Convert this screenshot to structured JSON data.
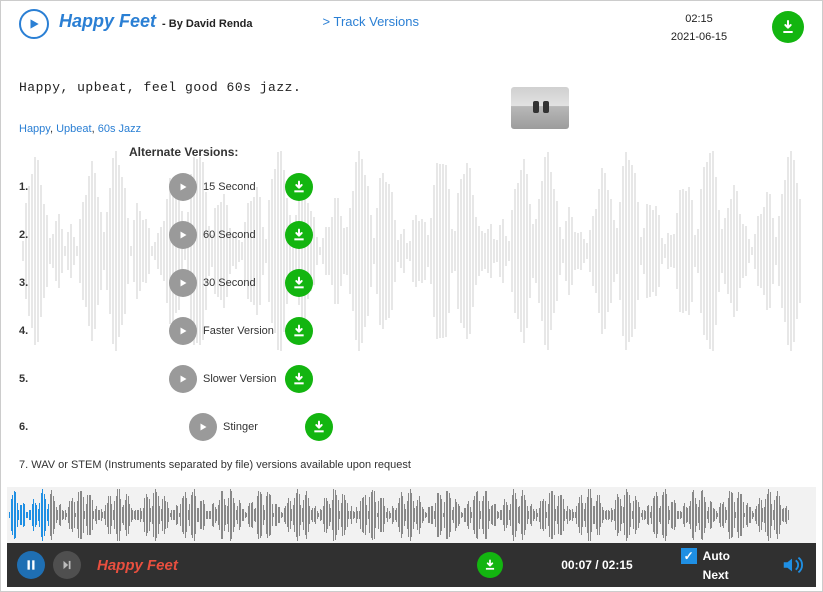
{
  "header": {
    "title": "Happy Feet",
    "by_prefix": "- By",
    "author": "David Renda",
    "versions_link": "> Track Versions",
    "duration": "02:15",
    "date": "2021-06-15"
  },
  "description": "Happy, upbeat, feel good 60s jazz.",
  "tags": [
    {
      "label": "Happy"
    },
    {
      "label": "Upbeat"
    },
    {
      "label": "60s Jazz"
    }
  ],
  "alt_header": "Alternate Versions:",
  "versions": [
    {
      "num": "1.",
      "label": "15 Second"
    },
    {
      "num": "2.",
      "label": "60 Second"
    },
    {
      "num": "3.",
      "label": "30 Second"
    },
    {
      "num": "4.",
      "label": "Faster Version"
    },
    {
      "num": "5.",
      "label": "Slower Version"
    },
    {
      "num": "6.",
      "label": "Stinger"
    }
  ],
  "note": "7. WAV or STEM (Instruments separated by file) versions available upon request",
  "player": {
    "now_playing": "Happy Feet",
    "elapsed": "00:07",
    "total": "02:15",
    "time_sep": " / ",
    "auto_label": "Auto",
    "next_label": "Next"
  }
}
